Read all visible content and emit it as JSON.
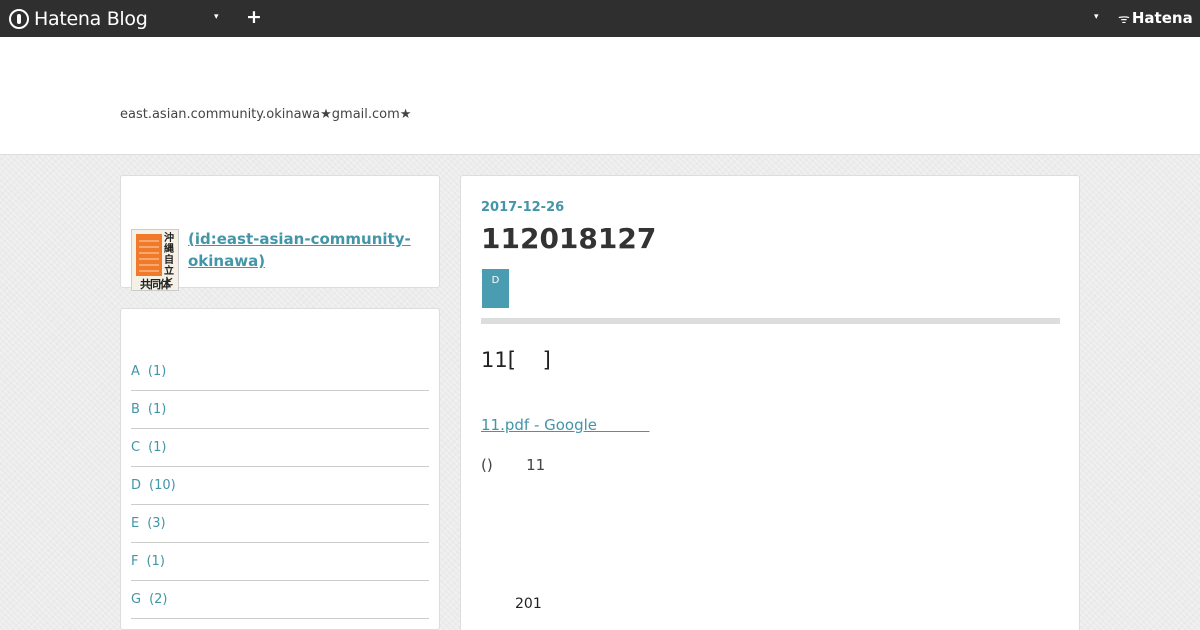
{
  "globalbar": {
    "logo_text": "Hatena Blog",
    "dropdown_caret": "▾",
    "new_post_label": "+",
    "account_caret": "▾",
    "hatena_label": "Hatena"
  },
  "blog": {
    "description": "east.asian.community.okinawa★gmail.com★"
  },
  "profile": {
    "name": " (id:east-asian-community-okinawa)",
    "image_text_vertical": "沖縄自立と",
    "image_text_bottom": "共同体"
  },
  "categories": [
    {
      "label": "A",
      "count": "(1)"
    },
    {
      "label": "B",
      "count": "(1)"
    },
    {
      "label": "C",
      "count": "(1)"
    },
    {
      "label": "D",
      "count": "(10)"
    },
    {
      "label": "E",
      "count": "(3)"
    },
    {
      "label": "F",
      "count": "(1)"
    },
    {
      "label": "G",
      "count": "(2)"
    }
  ],
  "article": {
    "date": "2017-12-26",
    "title": "112018127",
    "category_tag": "D",
    "heading": "11[    ]",
    "link_text": "11.pdf - Google           ",
    "paragraph1": "()       11",
    "paragraph2": "201"
  },
  "colors": {
    "accent": "#4395a8",
    "topbar": "#2f2f2f",
    "category_tag_bg": "#4a9db0"
  }
}
